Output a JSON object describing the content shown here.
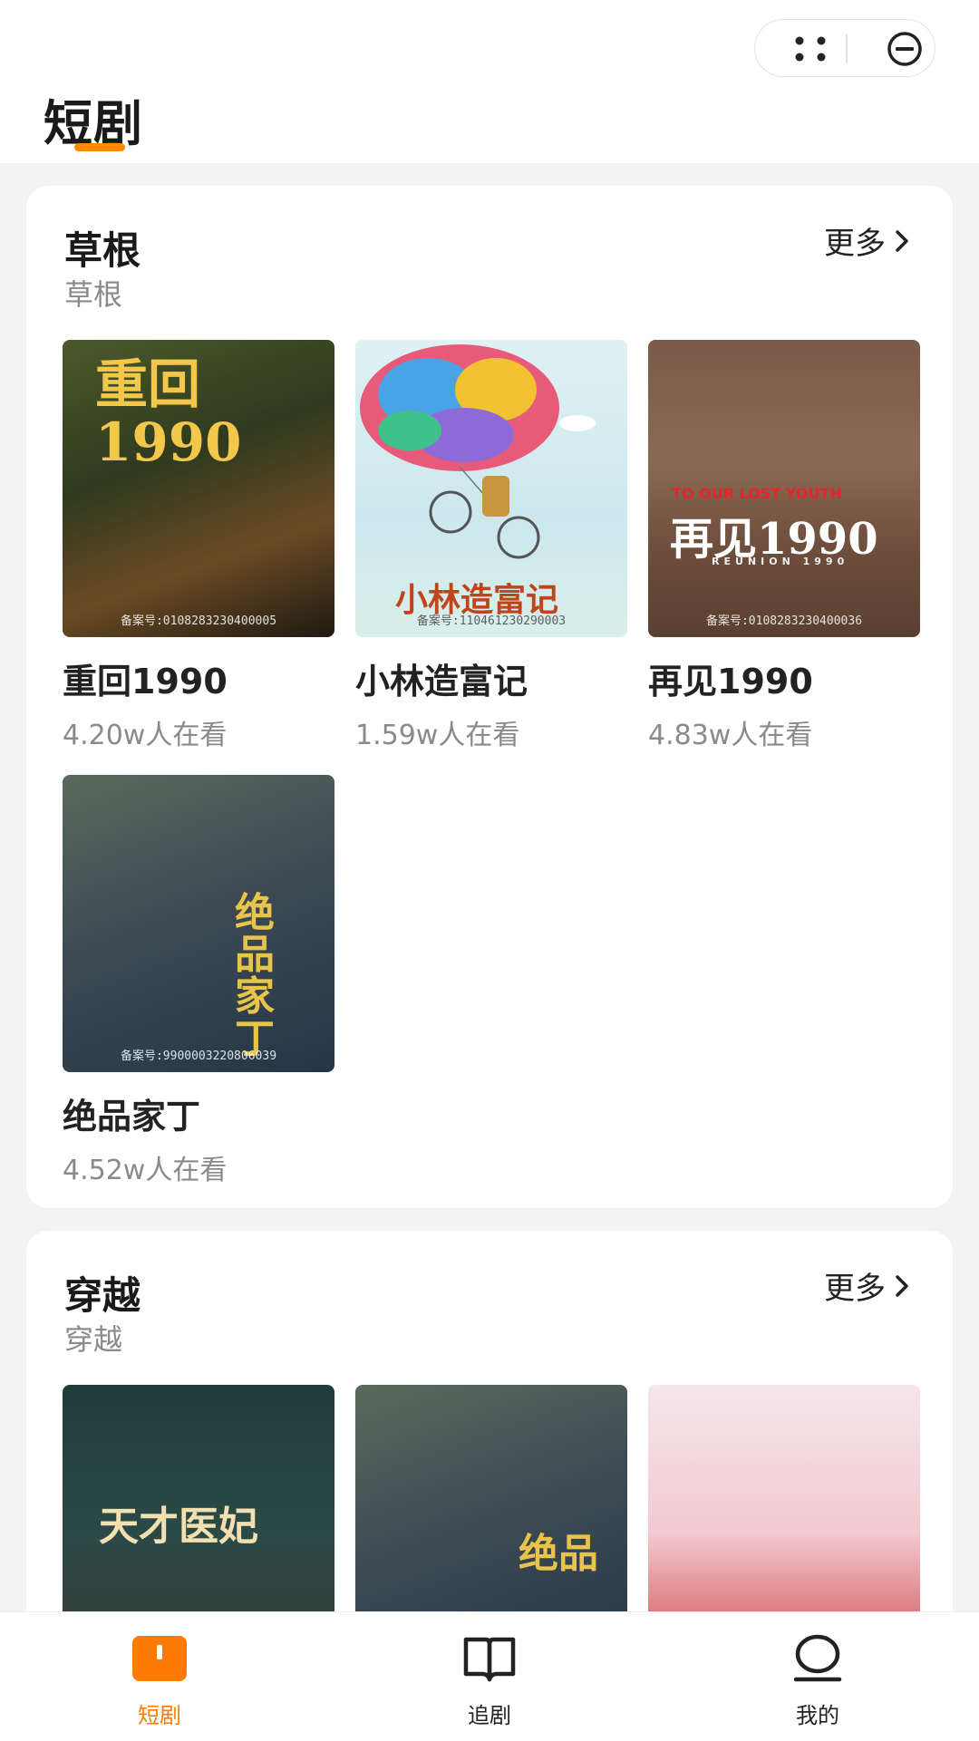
{
  "header": {
    "title": "短剧"
  },
  "capsule": {
    "menu_icon": "dots-menu-icon",
    "close_icon": "minus-circle-icon"
  },
  "sections": [
    {
      "title": "草根",
      "subtitle": "草根",
      "more_label": "更多",
      "items": [
        {
          "title": "重回1990",
          "views": "4.20w人在看",
          "poster_text": "重回1990",
          "license": "备案号:0108283230400005"
        },
        {
          "title": "小林造富记",
          "views": "1.59w人在看",
          "poster_text": "小林造富记",
          "license": "备案号:110461230290003"
        },
        {
          "title": "再见1990",
          "views": "4.83w人在看",
          "poster_text": "再见1990",
          "poster_text_en": "TO OUR LOST YOUTH",
          "poster_text_en2": "REUNION 1990",
          "license": "备案号:0108283230400036"
        },
        {
          "title": "绝品家丁",
          "views": "4.52w人在看",
          "poster_text": "绝品家丁",
          "license": "备案号:9900003220806039"
        }
      ]
    },
    {
      "title": "穿越",
      "subtitle": "穿越",
      "more_label": "更多",
      "items": [
        {
          "poster_text": "天才医妃"
        },
        {
          "poster_text": "绝品"
        },
        {
          "poster_text": ""
        }
      ]
    }
  ],
  "tabbar": {
    "items": [
      {
        "label": "短剧",
        "icon": "short-drama-icon",
        "active": true
      },
      {
        "label": "追剧",
        "icon": "book-icon",
        "active": false
      },
      {
        "label": "我的",
        "icon": "profile-icon",
        "active": false
      }
    ],
    "accent": "#ff7a00"
  }
}
